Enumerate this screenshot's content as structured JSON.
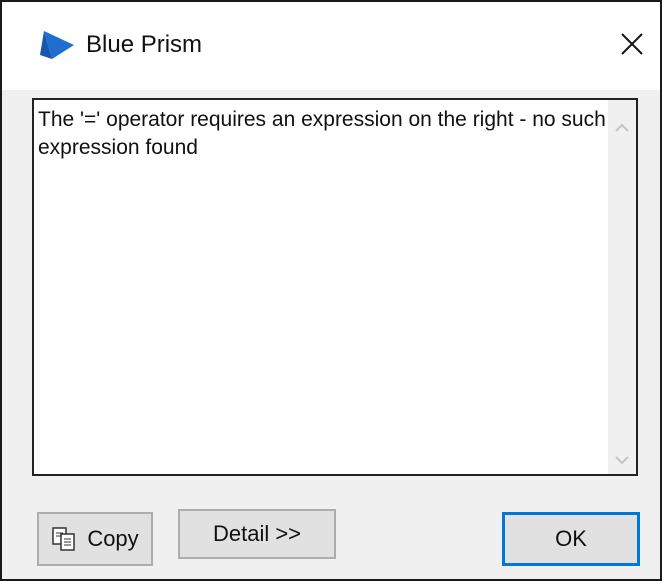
{
  "dialog": {
    "title": "Blue Prism",
    "close_icon": "close-icon",
    "app_icon": "blue-prism-logo-icon"
  },
  "message": {
    "text": "The '=' operator requires an expression on the right - no such expression found"
  },
  "buttons": {
    "copy_label": "Copy",
    "detail_label": "Detail >>",
    "ok_label": "OK"
  },
  "colors": {
    "brand_blue": "#1f6fd1",
    "focus_border": "#0078d7"
  }
}
